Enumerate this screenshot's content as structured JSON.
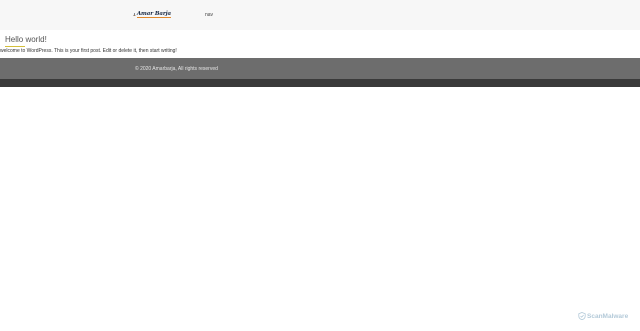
{
  "header": {
    "logo_text": "Amar Barja",
    "nav_label": "nav"
  },
  "post": {
    "title": "Hello world!",
    "body": "welcome to WordPress. This is your first post. Edit or delete it, then start writing!"
  },
  "footer": {
    "copyright": "© 2020 Amarbarja, All rights reserved"
  },
  "watermark": {
    "text": "ScanMalware"
  },
  "colors": {
    "header_bg": "#f7f7f7",
    "footer_bg": "#6d6d6d",
    "footer_bar": "#3a3a3a",
    "accent_underline": "#d4bf3a",
    "logo_accent": "#e2882b"
  }
}
